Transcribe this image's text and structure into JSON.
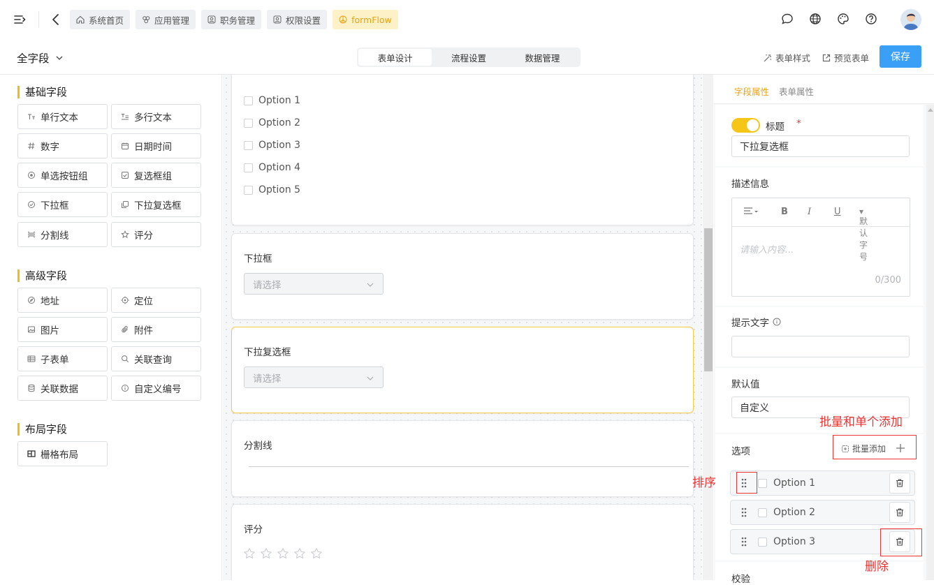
{
  "breadcrumbs": [
    {
      "label": "系统首页",
      "icon": "home-icon"
    },
    {
      "label": "应用管理",
      "icon": "apps-icon"
    },
    {
      "label": "职务管理",
      "icon": "user-card-icon"
    },
    {
      "label": "权限设置",
      "icon": "user-card-icon"
    },
    {
      "label": "formFlow",
      "icon": "peace-icon",
      "active": true
    }
  ],
  "top_icons": [
    "message-icon",
    "globe-icon",
    "palette-icon",
    "help-icon"
  ],
  "form_title": "全字段",
  "tabs": [
    {
      "label": "表单设计",
      "active": true
    },
    {
      "label": "流程设置"
    },
    {
      "label": "数据管理"
    }
  ],
  "toolbar": {
    "style_label": "表单样式",
    "preview_label": "预览表单",
    "save_label": "保存"
  },
  "basic_group": {
    "title": "基础字段",
    "items": [
      "单行文本",
      "多行文本",
      "数字",
      "日期时间",
      "单选按钮组",
      "复选框组",
      "下拉框",
      "下拉复选框",
      "分割线",
      "评分"
    ]
  },
  "advanced_group": {
    "title": "高级字段",
    "items": [
      "地址",
      "定位",
      "图片",
      "附件",
      "子表单",
      "关联查询",
      "关联数据",
      "自定义编号"
    ]
  },
  "layout_group": {
    "title": "布局字段",
    "items": [
      "栅格布局"
    ]
  },
  "canvas": {
    "checkbox_options": [
      "Option 1",
      "Option 2",
      "Option 3",
      "Option 4",
      "Option 5"
    ],
    "dropdown": {
      "label": "下拉框",
      "placeholder": "请选择"
    },
    "dropdown_multi": {
      "label": "下拉复选框",
      "placeholder": "请选择"
    },
    "divider": {
      "label": "分割线"
    },
    "rating": {
      "label": "评分",
      "stars": 5
    }
  },
  "right_panel": {
    "tabs": [
      {
        "label": "字段属性",
        "active": true
      },
      {
        "label": "表单属性"
      }
    ],
    "title_label": "标题",
    "title_required": "*",
    "title_value": "下拉复选框",
    "desc_label": "描述信息",
    "editor_font": "默认字号",
    "editor_placeholder": "请输入内容...",
    "editor_count": "0/300",
    "hint_label": "提示文字",
    "hint_value": "",
    "default_label": "默认值",
    "default_value": "自定义",
    "options_label": "选项",
    "batch_add_label": "批量添加",
    "options": [
      "Option 1",
      "Option 2",
      "Option 3"
    ],
    "validation_label": "校验"
  },
  "annotations": {
    "batch_add": "批量和单个添加",
    "sort": "排序",
    "delete": "删除"
  },
  "colors": {
    "accent": "#f5c518",
    "save_button": "#3aa0f7",
    "annotation": "#ee3333"
  }
}
